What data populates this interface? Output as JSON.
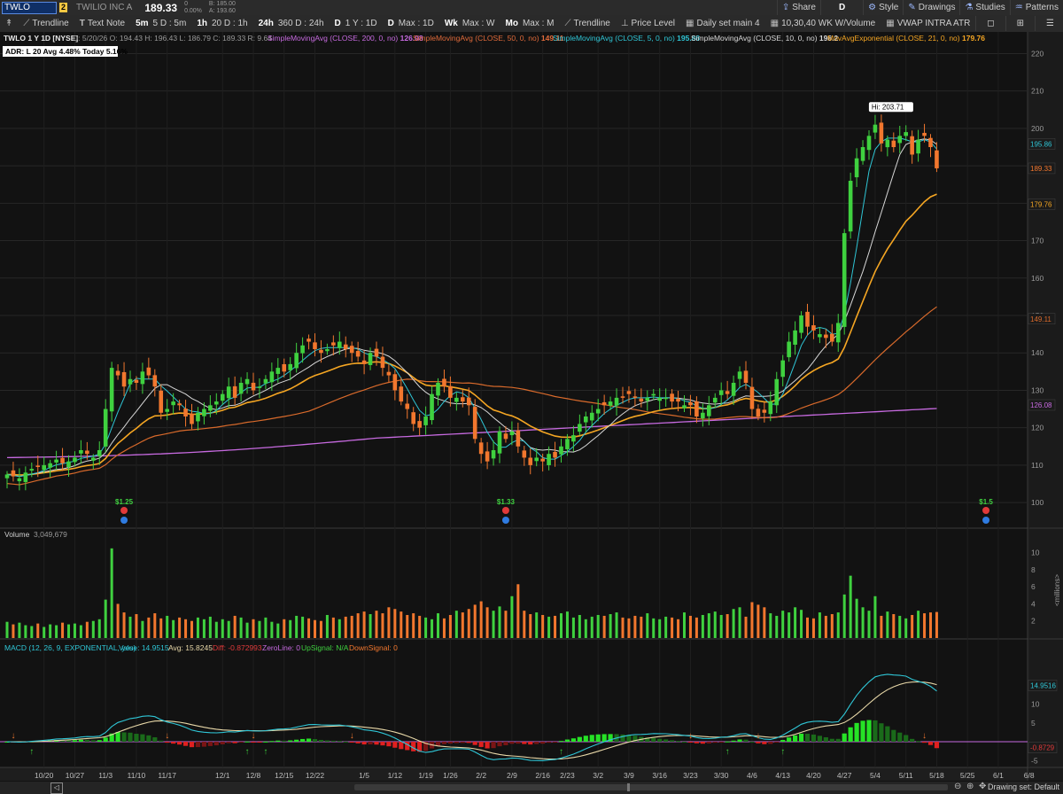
{
  "header": {
    "symbol": "TWLO",
    "link_number": "2",
    "company": "TWILIO INC A",
    "price": "189.33",
    "change": "0",
    "change_pct": "0.00%",
    "bid": "B: 185.00",
    "ask": "A: 193.60",
    "share_label": "Share",
    "style_label": "Style",
    "drawings_label": "Drawings",
    "studies_label": "Studies",
    "patterns_label": "Patterns",
    "timeframe_letter": "D"
  },
  "toolbar": {
    "trendline1": "Trendline",
    "textnote": "Text Note",
    "tf1_k": "5m",
    "tf1_v": "5 D : 5m",
    "tf2_k": "1h",
    "tf2_v": "20 D : 1h",
    "tf3_k": "24h",
    "tf3_v": "360 D : 24h",
    "tf4_k": "D",
    "tf4_v": "1 Y : 1D",
    "tf5_k": "D",
    "tf5_v": "Max : 1D",
    "tf6_k": "Wk",
    "tf6_v": "Max : W",
    "tf7_k": "Mo",
    "tf7_v": "Max : M",
    "trendline2": "Trendline",
    "pricelevel": "Price Level",
    "dailyset": "Daily set main 4",
    "wkvol": "10,30,40 WK W/Volume",
    "vwap": "VWAP INTRA ATR"
  },
  "colors": {
    "bg": "#121212",
    "up": "#3fd13f",
    "down": "#f2772e",
    "sma200": "#c76ae0",
    "sma50": "#d96a2b",
    "sma5": "#2fc6d6",
    "sma10": "#d8d8d8",
    "ema21": "#f5a623",
    "grid": "#272727"
  },
  "price_panel": {
    "info_symbol": "TWLO 1 Y 1D [NYSE]",
    "info_ohlc": "D: 5/20/26   O: 194.43   H: 196.43   L: 186.79   C: 189.33   R: 9.64",
    "studies": [
      {
        "label": "SimpleMovingAvg (CLOSE, 200, 0, no)",
        "value": "126.08",
        "color": "#c76ae0"
      },
      {
        "label": "SimpleMovingAvg (CLOSE, 50, 0, no)",
        "value": "149.11",
        "color": "#e06a3a"
      },
      {
        "label": "SimpleMovingAvg (CLOSE, 5, 0, no)",
        "value": "195.86",
        "color": "#2fc6d6"
      },
      {
        "label": "SimpleMovingAvg (CLOSE, 10, 0, no)",
        "value": "196.2",
        "color": "#d8d8d8"
      },
      {
        "label": "MovAvgExponential (CLOSE, 21, 0, no)",
        "value": "179.76",
        "color": "#f5a623"
      }
    ],
    "adr_label": "ADR: L 20  Avg 4.48%  Today 5.16%",
    "hi_label": "Hi: 203.71",
    "price_ticks": [
      "220",
      "210",
      "200",
      "190",
      "180",
      "170",
      "160",
      "150",
      "140",
      "130",
      "120",
      "110",
      "100"
    ],
    "right_labels": [
      {
        "text": "195.86",
        "price": 195.86,
        "color": "#2fc6d6"
      },
      {
        "text": "189.33",
        "price": 189.33,
        "color": "#f2772e"
      },
      {
        "text": "179.76",
        "price": 179.76,
        "color": "#f5a623"
      },
      {
        "text": "149.11",
        "price": 149.11,
        "color": "#d96a2b"
      },
      {
        "text": "126.08",
        "price": 126.08,
        "color": "#c76ae0"
      }
    ],
    "earnings": [
      {
        "label": "$1.25",
        "bar": 19
      },
      {
        "label": "$1.33",
        "bar": 81
      },
      {
        "label": "$1.5",
        "bar": 159
      }
    ]
  },
  "volume_panel": {
    "label": "Volume",
    "value": "3,049,679",
    "ticks": [
      "10",
      "8",
      "6",
      "4",
      "2"
    ],
    "unit_label": "<millions>"
  },
  "macd_panel": {
    "label": "MACD (12, 26, 9, EXPONENTIAL, yes)",
    "value_label": "Value: 14.9515",
    "avg_label": "Avg: 15.8245",
    "diff_label": "Diff: -0.872993",
    "zeroline_label": "ZeroLine: 0",
    "upsignal_label": "UpSignal: N/A",
    "downsignal_label": "DownSignal: 0",
    "ticks": [
      "10",
      "5",
      "-5"
    ],
    "value_tag": "14.9516",
    "diff_tag": "-0.8729"
  },
  "date_axis": [
    {
      "label": "10/20",
      "bar": 6
    },
    {
      "label": "10/27",
      "bar": 11
    },
    {
      "label": "11/3",
      "bar": 16
    },
    {
      "label": "11/10",
      "bar": 21
    },
    {
      "label": "11/17",
      "bar": 26
    },
    {
      "label": "12/1",
      "bar": 35
    },
    {
      "label": "12/8",
      "bar": 40
    },
    {
      "label": "12/15",
      "bar": 45
    },
    {
      "label": "12/22",
      "bar": 50
    },
    {
      "label": "1/5",
      "bar": 58
    },
    {
      "label": "1/12",
      "bar": 63
    },
    {
      "label": "1/19",
      "bar": 68
    },
    {
      "label": "1/26",
      "bar": 72
    },
    {
      "label": "2/2",
      "bar": 77
    },
    {
      "label": "2/9",
      "bar": 82
    },
    {
      "label": "2/16",
      "bar": 87
    },
    {
      "label": "2/23",
      "bar": 91
    },
    {
      "label": "3/2",
      "bar": 96
    },
    {
      "label": "3/9",
      "bar": 101
    },
    {
      "label": "3/16",
      "bar": 106
    },
    {
      "label": "3/23",
      "bar": 111
    },
    {
      "label": "3/30",
      "bar": 116
    },
    {
      "label": "4/6",
      "bar": 121
    },
    {
      "label": "4/13",
      "bar": 126
    },
    {
      "label": "4/20",
      "bar": 131
    },
    {
      "label": "4/27",
      "bar": 136
    },
    {
      "label": "5/4",
      "bar": 141
    },
    {
      "label": "5/11",
      "bar": 146
    },
    {
      "label": "5/18",
      "bar": 151
    },
    {
      "label": "5/25",
      "bar": 156
    },
    {
      "label": "6/1",
      "bar": 161
    },
    {
      "label": "6/8",
      "bar": 166
    }
  ],
  "footer": {
    "drawing_set": "Drawing set: Default"
  },
  "chart_data": {
    "type": "candlestick",
    "title": "TWLO 1 Y 1D [NYSE]",
    "ylim": [
      96,
      222
    ],
    "closes": [
      107.5,
      107,
      106.5,
      108,
      109,
      109.5,
      110,
      110.5,
      111.5,
      110.5,
      111,
      112,
      114,
      113,
      112,
      114,
      125,
      136,
      134,
      131,
      133,
      132,
      135,
      134,
      131,
      124,
      125,
      127,
      126,
      123,
      121,
      124,
      125,
      126,
      127,
      129,
      131,
      128,
      132,
      133,
      130,
      131,
      133,
      135,
      136,
      135,
      137,
      140,
      142,
      143,
      141,
      140,
      141,
      142,
      143,
      141,
      140,
      139,
      137,
      140,
      139,
      136,
      134,
      130,
      127,
      125,
      121,
      120,
      123,
      129,
      132,
      131,
      128,
      128,
      127,
      126,
      117,
      113,
      111,
      114,
      119,
      117,
      119,
      115,
      112,
      110,
      112,
      111,
      113,
      112,
      115,
      117,
      118,
      121,
      123,
      124,
      125,
      126,
      127,
      128,
      128,
      129,
      128,
      127,
      128,
      129,
      128,
      128,
      127,
      127,
      126,
      126,
      123,
      124,
      126,
      128,
      130,
      129,
      132,
      135,
      132,
      125,
      123,
      124,
      127,
      133,
      138,
      143,
      146,
      150,
      147,
      146,
      145,
      144,
      143,
      148,
      172,
      186,
      192,
      195,
      198,
      201,
      196,
      197,
      195,
      198,
      199,
      193,
      197,
      198,
      195,
      189.33
    ],
    "volume_millions": [
      1.9,
      1.6,
      1.8,
      1.5,
      1.4,
      1.7,
      1.3,
      1.6,
      1.5,
      1.8,
      1.6,
      1.7,
      1.5,
      1.9,
      2.0,
      2.2,
      4.5,
      10.5,
      4.0,
      3.0,
      2.5,
      2.8,
      2.0,
      2.4,
      2.9,
      2.3,
      2.6,
      2.1,
      2.4,
      2.2,
      2.0,
      2.4,
      2.2,
      2.5,
      1.9,
      2.2,
      2.0,
      2.6,
      2.4,
      1.8,
      2.2,
      2.0,
      2.4,
      1.9,
      1.7,
      2.2,
      2.1,
      2.6,
      2.5,
      2.3,
      2.1,
      2.0,
      2.7,
      2.4,
      2.2,
      2.5,
      2.6,
      2.9,
      3.1,
      2.8,
      3.2,
      2.9,
      3.6,
      3.4,
      3.1,
      2.7,
      2.9,
      2.6,
      2.4,
      2.2,
      2.9,
      2.3,
      2.7,
      3.2,
      3.0,
      3.4,
      3.9,
      4.3,
      3.6,
      3.2,
      3.7,
      3.2,
      4.9,
      6.3,
      3.2,
      2.8,
      3.0,
      2.7,
      2.5,
      2.6,
      2.9,
      3.1,
      2.4,
      2.7,
      2.2,
      2.5,
      2.7,
      2.6,
      2.8,
      3.0,
      2.4,
      2.3,
      2.6,
      2.5,
      2.9,
      2.3,
      2.2,
      2.5,
      2.4,
      2.2,
      3.0,
      2.6,
      2.4,
      2.7,
      2.9,
      3.1,
      2.7,
      2.8,
      3.4,
      3.6,
      2.5,
      4.2,
      3.9,
      3.6,
      2.9,
      2.6,
      3.2,
      3.0,
      3.6,
      3.3,
      2.4,
      2.3,
      3.0,
      2.6,
      2.8,
      3.0,
      5.1,
      7.3,
      4.6,
      3.6,
      3.2,
      4.9,
      2.6,
      3.1,
      2.8,
      2.6,
      2.3,
      2.7,
      3.2,
      2.9,
      3.0,
      3.05
    ],
    "macd": {
      "value": 14.9515,
      "avg": 15.8245,
      "diff": -0.872993
    }
  }
}
